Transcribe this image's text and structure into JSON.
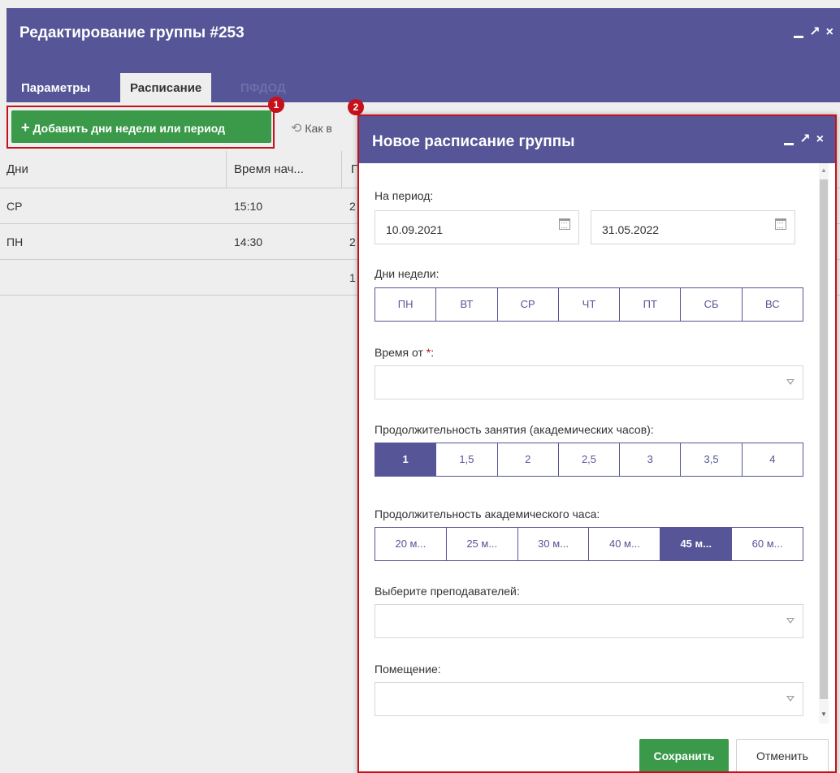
{
  "outer_window": {
    "title": "Редактирование группы #253",
    "controls": {
      "minimize": "_",
      "maximize": "↗",
      "close": "×"
    },
    "tabs": [
      {
        "label": "Параметры"
      },
      {
        "label": "Расписание"
      },
      {
        "label": "ПФДОД"
      }
    ]
  },
  "toolbar": {
    "add_label": "Добавить дни недели или период",
    "add_icon": "plus-icon",
    "like_label": "Как в",
    "like_icon": "history-icon"
  },
  "markers": [
    "1",
    "2"
  ],
  "table": {
    "headers": [
      "Дни",
      "Время нач...",
      "Г"
    ],
    "rows": [
      {
        "days": "СР",
        "time": "15:10",
        "col3": "2"
      },
      {
        "days": "ПН",
        "time": "14:30",
        "col3": "2"
      },
      {
        "days": "",
        "time": "",
        "col3": "1"
      }
    ]
  },
  "modal": {
    "title": "Новое расписание группы",
    "period_label": "На период:",
    "date_from": "10.09.2021",
    "date_to": "31.05.2022",
    "weekdays_label": "Дни недели:",
    "weekdays": [
      "ПН",
      "ВТ",
      "СР",
      "ЧТ",
      "ПТ",
      "СБ",
      "ВС"
    ],
    "time_from_label": "Время от",
    "required_mark": "*",
    "time_from_suffix": ":",
    "duration_label": "Продолжительность занятия (академических часов):",
    "durations": [
      "1",
      "1,5",
      "2",
      "2,5",
      "3",
      "3,5",
      "4"
    ],
    "duration_selected": "1",
    "hour_length_label": "Продолжительность академического часа:",
    "hour_lengths": [
      "20 м...",
      "25 м...",
      "30 м...",
      "40 м...",
      "45 м...",
      "60 м..."
    ],
    "hour_length_selected": "45 м...",
    "teachers_label": "Выберите преподавателей:",
    "room_label": "Помещение:",
    "save_label": "Сохранить",
    "cancel_label": "Отменить"
  },
  "colors": {
    "header": "#555597",
    "accent_green": "#3a9a4a",
    "highlight_red": "#c6111b"
  }
}
